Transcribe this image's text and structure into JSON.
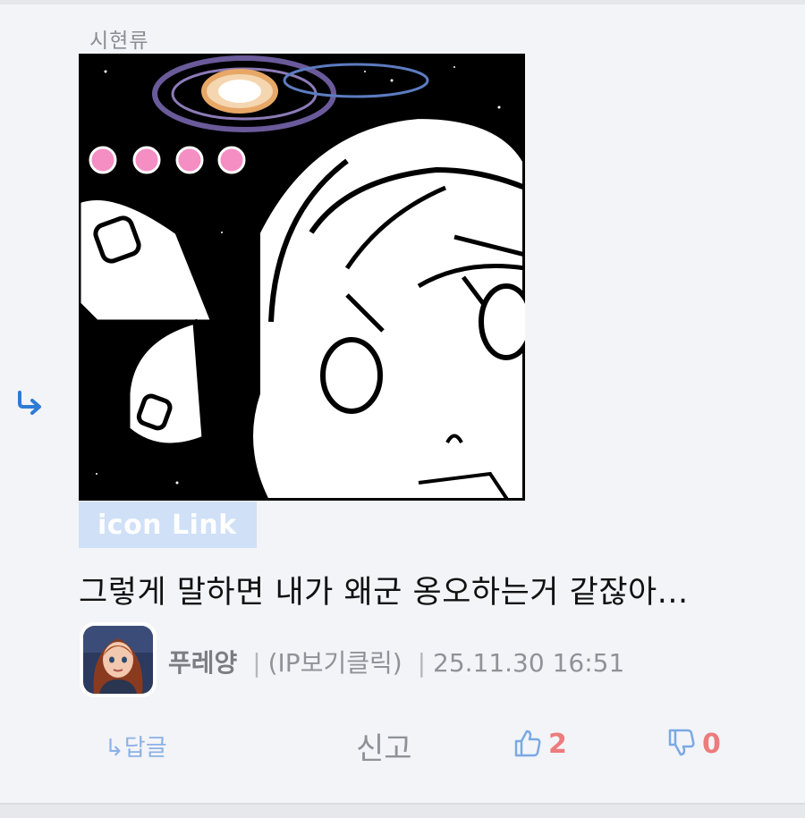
{
  "post": {
    "category": "시현류",
    "icon_link_label": "icon Link",
    "comment_text": "그렇게 말하면 내가 왜군 옹오하는거 같잖아...",
    "author": "푸레양",
    "ip_label": "(IP보기클릭)",
    "separator": "|",
    "timestamp": "25.11.30 16:51"
  },
  "actions": {
    "reply_label": "↳답글",
    "report_label": "신고",
    "like_count": "2",
    "dislike_count": "0"
  },
  "icons": {
    "reply_arrow": "reply-arrow-icon",
    "thumbs_up": "thumbs-up-icon",
    "thumbs_down": "thumbs-down-icon"
  },
  "colors": {
    "accent_blue": "#2e7bd6",
    "count_red": "#ec7c7c",
    "icon_link_bg": "#cfe0f7",
    "background": "#f3f4f8"
  }
}
